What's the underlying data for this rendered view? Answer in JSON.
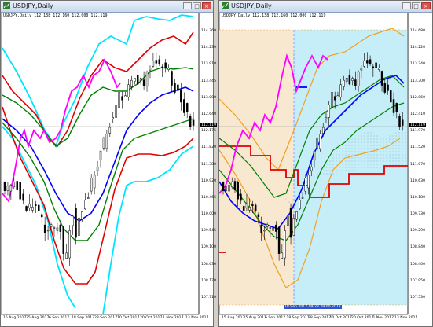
{
  "left": {
    "title": "USDJPY,Daily",
    "info": "USDJPY,Daily  112.138 112.160 112.000 112.119",
    "last_price": "112.119",
    "y_labels": [
      "114.760",
      "114.230",
      "113.910",
      "113.445",
      "113.000",
      "112.640",
      "112.175",
      "111.820",
      "111.380",
      "110.920",
      "110.465",
      "110.000",
      "109.545",
      "109.100",
      "108.630",
      "108.170",
      "107.710"
    ],
    "x_labels": [
      "15 Aug 2017",
      "25 Aug 2017",
      "6 Sep 2017",
      "18 Sep 2017",
      "28 Sep 2017",
      "10 Oct 2017",
      "20 Oct 2017",
      "1 Nov 2017",
      "13 Nov 2017"
    ]
  },
  "right": {
    "title": "USDJPY,Daily",
    "info": "USDJPY,Daily  112.138 112.160 112.000 112.119",
    "last_price": "112.119",
    "y_labels": [
      "114.680",
      "114.220",
      "113.740",
      "113.300",
      "112.860",
      "112.410",
      "111.970",
      "111.520",
      "111.070",
      "110.630",
      "110.180",
      "109.730",
      "109.290",
      "108.840",
      "108.400",
      "107.950",
      "107.530"
    ],
    "x_labels": [
      "15 Aug 2017",
      "25 Aug 2017",
      "6 Sep 2017",
      "18 Sep 2017",
      "28 Sep 2017",
      "10 Oct 2017",
      "20 Oct 2017",
      "1 Nov 2017",
      "13 Nov 2017"
    ],
    "highlight_label": "18 Sep 2017 09:23 28:00 2017",
    "vline_label": "2017.09.15"
  },
  "colors": {
    "candle": "#000000",
    "bb_outer": "#00e5ff",
    "bb_mid": "#e00000",
    "bb_inner": "#008000",
    "sma": "#0000ff",
    "chikou": "#ff00ff",
    "cloud_fill": "#c6eef8",
    "cloud_shade": "#f8e8d0",
    "kijun": "#e00000",
    "bb_orange": "#f0a020"
  }
}
